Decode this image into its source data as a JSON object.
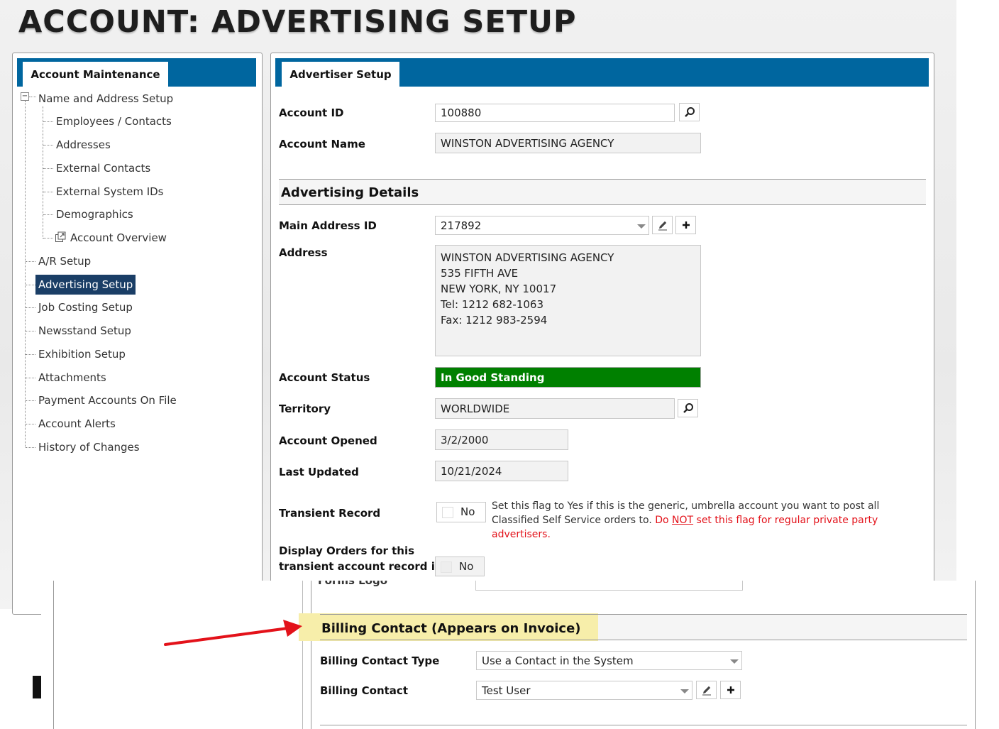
{
  "page": {
    "title": "ACCOUNT: ADVERTISING SETUP"
  },
  "left_panel": {
    "tab": "Account Maintenance",
    "tree": {
      "root": "Name and Address Setup",
      "children": [
        "Employees / Contacts",
        "Addresses",
        "External Contacts",
        "External System IDs",
        "Demographics",
        "Account Overview"
      ],
      "items": [
        "A/R Setup",
        "Advertising Setup",
        "Job Costing Setup",
        "Newsstand Setup",
        "Exhibition Setup",
        "Attachments",
        "Payment Accounts On File",
        "Account Alerts",
        "History of Changes"
      ],
      "selected": "Advertising Setup"
    }
  },
  "right_panel": {
    "tab": "Advertiser Setup",
    "account_id": {
      "label": "Account ID",
      "value": "100880"
    },
    "account_name": {
      "label": "Account Name",
      "value": "WINSTON ADVERTISING AGENCY"
    },
    "section_title": "Advertising Details",
    "main_address_id": {
      "label": "Main Address ID",
      "value": "217892"
    },
    "address": {
      "label": "Address",
      "lines": [
        "WINSTON ADVERTISING AGENCY",
        "535 FIFTH AVE",
        "NEW YORK, NY 10017",
        "Tel: 1212 682-1063",
        "Fax: 1212 983-2594"
      ]
    },
    "account_status": {
      "label": "Account Status",
      "value": "In Good Standing",
      "color": "#008000"
    },
    "territory": {
      "label": "Territory",
      "value": "WORLDWIDE"
    },
    "account_opened": {
      "label": "Account Opened",
      "value": "3/2/2000"
    },
    "last_updated": {
      "label": "Last Updated",
      "value": "10/21/2024"
    },
    "transient_record": {
      "label": "Transient Record",
      "value": "No",
      "note_part1": "Set this flag to Yes if this is the generic, umbrella account you want to post all Classified Self Service orders to. ",
      "note_red_a": "Do ",
      "note_red_u": "NOT",
      "note_red_b": " set this flag for regular private party advertisers."
    },
    "display_orders": {
      "label_line1": "Display Orders for this",
      "label_line2": "transient account record in",
      "value": "No"
    }
  },
  "lower": {
    "cut_label": "Forms Logo",
    "billing_section": {
      "title": "Billing Contact (Appears on Invoice)",
      "highlight": "#f7eeaa"
    },
    "billing_contact_type": {
      "label": "Billing Contact Type",
      "value": "Use a Contact in the System"
    },
    "billing_contact": {
      "label": "Billing Contact",
      "value": "Test User"
    }
  },
  "colors": {
    "accent": "#00669f",
    "selected": "#1a3e66",
    "arrow": "#e3121a"
  }
}
